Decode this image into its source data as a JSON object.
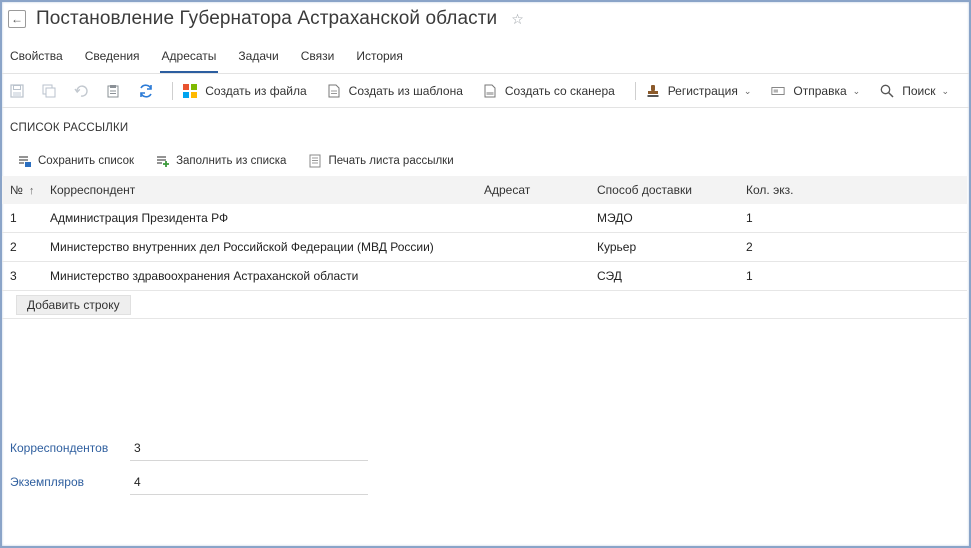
{
  "header": {
    "title": "Постановление Губернатора Астраханской области"
  },
  "tabs": [
    {
      "label": "Свойства"
    },
    {
      "label": "Сведения"
    },
    {
      "label": "Адресаты",
      "active": true
    },
    {
      "label": "Задачи"
    },
    {
      "label": "Связи"
    },
    {
      "label": "История"
    }
  ],
  "toolbar": {
    "create_from_file": "Создать из файла",
    "create_from_template": "Создать из шаблона",
    "create_from_scanner": "Создать со сканера",
    "registration": "Регистрация",
    "sending": "Отправка",
    "search": "Поиск"
  },
  "section": {
    "title": "СПИСОК РАССЫЛКИ",
    "save_list": "Сохранить список",
    "fill_from_list": "Заполнить из списка",
    "print_list": "Печать листа рассылки"
  },
  "table": {
    "headers": {
      "num": "№",
      "correspondent": "Корреспондент",
      "addressee": "Адресат",
      "delivery": "Способ доставки",
      "copies": "Кол. экз."
    },
    "rows": [
      {
        "num": "1",
        "correspondent": "Администрация Президента РФ",
        "addressee": "",
        "delivery": "МЭДО",
        "copies": "1"
      },
      {
        "num": "2",
        "correspondent": "Министерство внутренних дел Российской Федерации (МВД России)",
        "addressee": "",
        "delivery": "Курьер",
        "copies": "2"
      },
      {
        "num": "3",
        "correspondent": "Министерство здравоохранения Астраханской области",
        "addressee": "",
        "delivery": "СЭД",
        "copies": "1"
      }
    ],
    "add_row": "Добавить строку"
  },
  "summary": {
    "correspondents_label": "Корреспондентов",
    "correspondents_value": "3",
    "copies_label": "Экземпляров",
    "copies_value": "4"
  },
  "colors": {
    "accent": "#2c5ea0",
    "label_blue": "#2f5f9f",
    "header_bg": "#f3f3f3"
  }
}
